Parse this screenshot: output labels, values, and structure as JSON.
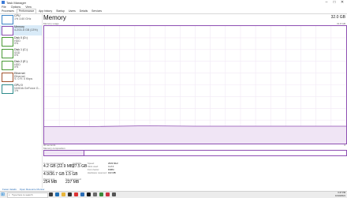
{
  "window": {
    "title": "Task Manager",
    "menu": [
      "File",
      "Options",
      "View"
    ],
    "tabs": [
      "Processes",
      "Performance",
      "App history",
      "Startup",
      "Users",
      "Details",
      "Services"
    ],
    "active_tab": "Performance"
  },
  "sidebar": {
    "items": [
      {
        "name": "CPU",
        "sub1": "1% 3.60 GHz",
        "sub2": ""
      },
      {
        "name": "Memory",
        "sub1": "4.2/31.8 GB (13%)",
        "sub2": ""
      },
      {
        "name": "Disk 0 (D:)",
        "sub1": "HDD",
        "sub2": "0%"
      },
      {
        "name": "Disk 1 (C:)",
        "sub1": "SSD",
        "sub2": "0%"
      },
      {
        "name": "Disk 2 (E:)",
        "sub1": "HDD",
        "sub2": "0%"
      },
      {
        "name": "Ethernet",
        "sub1": "Ethernet",
        "sub2": "S: 0 R: 0 Kbps"
      },
      {
        "name": "GPU 0",
        "sub1": "NVIDIA GeForce G...",
        "sub2": "1%"
      }
    ]
  },
  "memory": {
    "title": "Memory",
    "total": "32.0 GB",
    "usage_label": "Memory usage",
    "usage_max": "31.8 GB",
    "seconds_label": "60 seconds",
    "zero_label": "0",
    "composition_label": "Memory composition"
  },
  "chart_data": {
    "type": "area",
    "title": "",
    "xlabel": "",
    "ylabel": "",
    "ylim": [
      0,
      31.8
    ],
    "x": [
      60,
      50,
      40,
      30,
      20,
      10,
      0
    ],
    "series": [
      {
        "values": [
          4.6,
          4.6,
          4.8,
          4.7,
          4.7,
          4.7,
          4.7
        ]
      }
    ],
    "composition_fraction": 0.13
  },
  "stats": {
    "in_use_label": "In use (Compressed)",
    "in_use_value": "4.2 GB (22.9 MB)",
    "available_label": "Available",
    "available_value": "27.5 GB",
    "committed_label": "Committed",
    "committed_value": "4.9/36.7 GB",
    "cached_label": "Cached",
    "cached_value": "1.5 GB",
    "paged_label": "Paged pool",
    "paged_value": "254 MB",
    "nonpaged_label": "Non-paged pool",
    "nonpaged_value": "237 MB",
    "speed_label": "Speed:",
    "speed_value": "2933 MHz",
    "slots_label": "Slots used:",
    "slots_value": "4 of 4",
    "form_label": "Form factor:",
    "form_value": "DIMM",
    "reserved_label": "Hardware reserved:",
    "reserved_value": "162 MB"
  },
  "footer": {
    "fewer_details": "Fewer details",
    "open_monitor": "Open Resource Monitor"
  },
  "taskbar": {
    "search_placeholder": "Type here to search",
    "time": "6:47 PM",
    "date": "10/10/2021"
  },
  "colors": {
    "accent": "#8e4fb2",
    "fill": "#f0e5f5",
    "selected": "#d9ebf8"
  }
}
